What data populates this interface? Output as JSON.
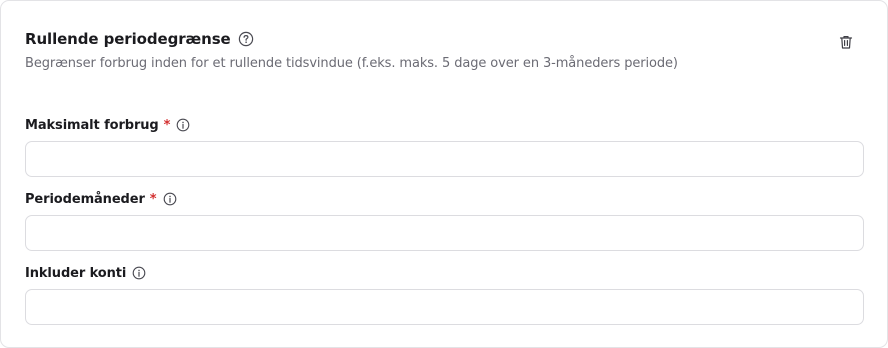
{
  "card": {
    "title": "Rullende periodegrænse",
    "description": "Begrænser forbrug inden for et rullende tidsvindue (f.eks. maks. 5 dage over en 3-måneders periode)",
    "help_icon": "help-circle-icon",
    "delete_icon": "trash-icon"
  },
  "fields": [
    {
      "label": "Maksimalt forbrug",
      "required_marker": "*",
      "value": "",
      "info_icon": "info-icon"
    },
    {
      "label": "Periodemåneder",
      "required_marker": "*",
      "value": "",
      "info_icon": "info-icon"
    },
    {
      "label": "Inkluder konti",
      "value": "",
      "info_icon": "info-icon"
    }
  ],
  "colors": {
    "required": "#d32f2f",
    "border": "#dcdce0",
    "text": "#1b1b1f",
    "muted": "#6b6b74"
  }
}
